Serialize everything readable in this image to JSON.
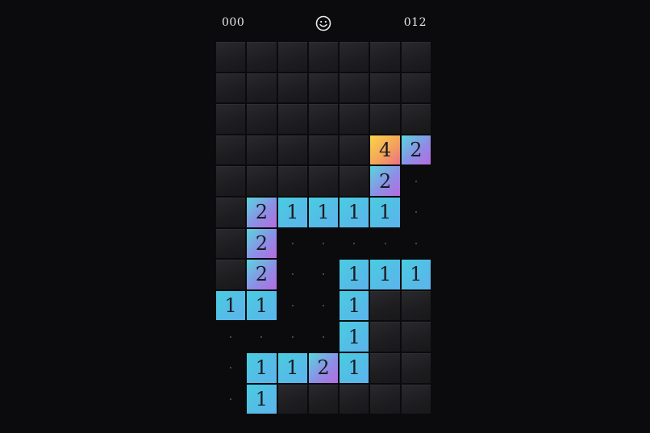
{
  "hud": {
    "mines_left": "000",
    "timer": "012",
    "reset_icon": "smiley-face-icon"
  },
  "board": {
    "cols": 7,
    "rows": 12,
    "cells": [
      [
        "H",
        "H",
        "H",
        "H",
        "H",
        "H",
        "H"
      ],
      [
        "H",
        "H",
        "H",
        "H",
        "H",
        "H",
        "H"
      ],
      [
        "H",
        "H",
        "H",
        "H",
        "H",
        "H",
        "H"
      ],
      [
        "H",
        "H",
        "H",
        "H",
        "H",
        "4",
        "2"
      ],
      [
        "H",
        "H",
        "H",
        "H",
        "H",
        "2",
        "0"
      ],
      [
        "H",
        "2",
        "1",
        "1",
        "1",
        "1",
        "0"
      ],
      [
        "H",
        "2",
        "0",
        "0",
        "0",
        "0",
        "0"
      ],
      [
        "H",
        "2",
        "0",
        "0",
        "1",
        "1",
        "1"
      ],
      [
        "1",
        "1",
        "0",
        "0",
        "1",
        "H",
        "H"
      ],
      [
        "0",
        "0",
        "0",
        "0",
        "1",
        "H",
        "H"
      ],
      [
        "0",
        "1",
        "1",
        "2",
        "1",
        "H",
        "H"
      ],
      [
        "0",
        "1",
        "H",
        "H",
        "H",
        "H",
        "H"
      ]
    ]
  },
  "colors": {
    "background": "#0b0b0d",
    "hidden_tile": "#232326",
    "number_1": "#54bde6",
    "number_2": "#8c8fe6",
    "number_4": "#f3a55a"
  }
}
